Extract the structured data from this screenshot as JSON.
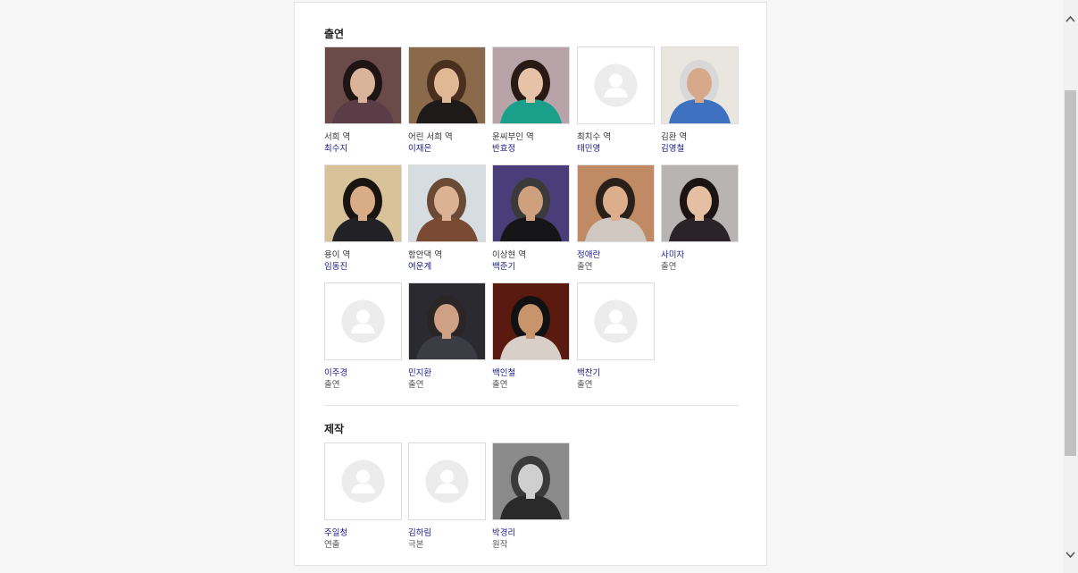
{
  "cast": {
    "title": "출연",
    "items": [
      {
        "role": "서희 역",
        "name": "최수지",
        "photo": true,
        "bg": "#6b4a4a",
        "skin": "#d9b49a",
        "hair": "#1e1414",
        "cloth": "#5b3d48"
      },
      {
        "role": "어린 서희 역",
        "name": "이재은",
        "photo": true,
        "bg": "#8a6a4a",
        "skin": "#e0b896",
        "hair": "#4a2e1e",
        "cloth": "#1e1a1a"
      },
      {
        "role": "윤씨부인 역",
        "name": "반효정",
        "photo": true,
        "bg": "#b8a4a8",
        "skin": "#e6c2a6",
        "hair": "#2a1a16",
        "cloth": "#1aa08a"
      },
      {
        "role": "최치수 역",
        "name": "태민영",
        "photo": false
      },
      {
        "role": "김환 역",
        "name": "김영철",
        "photo": true,
        "bg": "#e9e6df",
        "skin": "#d7a98a",
        "hair": "#d8d8d8",
        "cloth": "#3e72c0"
      },
      {
        "role": "용이 역",
        "name": "임동진",
        "photo": true,
        "bg": "#d8c29a",
        "skin": "#d9ac88",
        "hair": "#1a1410",
        "cloth": "#222226"
      },
      {
        "role": "함안댁 역",
        "name": "여운계",
        "photo": true,
        "bg": "#d6dde0",
        "skin": "#dcb294",
        "hair": "#6a4a34",
        "cloth": "#7a4a32"
      },
      {
        "role": "이상현 역",
        "name": "백준기",
        "photo": true,
        "bg": "#4a3e7a",
        "skin": "#cfa07e",
        "hair": "#3a3a3a",
        "cloth": "#161618"
      },
      {
        "role": "정애란",
        "name": "출연",
        "photo": true,
        "bg": "#c08a64",
        "skin": "#dcae8c",
        "hair": "#2a201a",
        "cloth": "#d0c8c0",
        "roleLink": true
      },
      {
        "role": "사미자",
        "name": "출연",
        "photo": true,
        "bg": "#b8b4b4",
        "skin": "#e4bfa2",
        "hair": "#1c1414",
        "cloth": "#2a2428",
        "roleLink": true
      },
      {
        "role": "이주경",
        "name": "출연",
        "photo": false,
        "roleLink": true
      },
      {
        "role": "민지환",
        "name": "출연",
        "photo": true,
        "bg": "#2a2a30",
        "skin": "#cfa084",
        "hair": "#2a2626",
        "cloth": "#3c3c44",
        "roleLink": true
      },
      {
        "role": "백인철",
        "name": "출연",
        "photo": true,
        "bg": "#5a1a10",
        "skin": "#c8946c",
        "hair": "#111",
        "cloth": "#d8d0c8",
        "roleLink": true
      },
      {
        "role": "백찬기",
        "name": "출연",
        "photo": false,
        "roleLink": true
      }
    ]
  },
  "production": {
    "title": "제작",
    "items": [
      {
        "role": "주일청",
        "name": "연출",
        "photo": false,
        "roleLink": true
      },
      {
        "role": "김하림",
        "name": "극본",
        "photo": false,
        "roleLink": true
      },
      {
        "role": "박경리",
        "name": "원작",
        "photo": true,
        "bg": "#8a8a8a",
        "skin": "#cfcfcf",
        "hair": "#3a3a3a",
        "cloth": "#2a2a2a",
        "roleLink": true
      }
    ]
  }
}
